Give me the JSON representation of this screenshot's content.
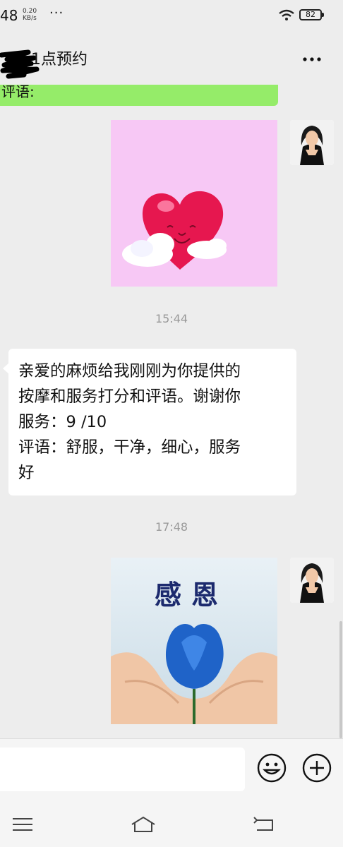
{
  "status_bar": {
    "time": "48",
    "speed_value": "0.20",
    "speed_unit": "KB/s",
    "dots": "···",
    "battery": "82"
  },
  "header": {
    "title": "1点预约",
    "more_icon": "more-dots-icon"
  },
  "messages": {
    "partial_green_text": "评语:",
    "timestamp_1": "15:44",
    "timestamp_2": "17:48",
    "incoming_lines": [
      "亲爱的麻烦给我刚刚为你提供的",
      "按摩和服务打分和评语。谢谢你",
      "服务：9 /10",
      "评语：舒服，干净，细心，服务",
      "好"
    ],
    "sticker_2_text": "感恩"
  },
  "colors": {
    "background": "#ededed",
    "sent_bubble": "#95ec69",
    "received_bubble": "#ffffff",
    "heart": "#e6174f",
    "sticker_pink": "#f7c8f5",
    "rose": "#1f63c8"
  },
  "icons": {
    "wifi": "wifi-icon",
    "battery": "battery-icon",
    "emoji": "emoji-icon",
    "plus": "plus-circle-icon",
    "menu": "menu-icon",
    "home": "home-icon",
    "back": "back-icon"
  }
}
